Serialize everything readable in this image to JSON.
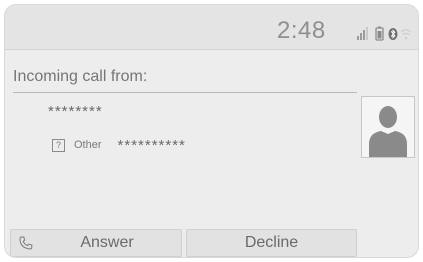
{
  "status": {
    "clock": "2:48",
    "icons": [
      "signal-icon",
      "battery-icon",
      "bluetooth-icon",
      "wifi-icon"
    ]
  },
  "call": {
    "title": "Incoming call from:",
    "caller_number": "********",
    "other_label": "Other",
    "other_number": "**********",
    "contact_icon": "person-silhouette"
  },
  "buttons": {
    "answer": "Answer",
    "decline": "Decline"
  },
  "colors": {
    "background": "#ededed",
    "text": "#6a6a6a",
    "avatar": "#8a8a8a"
  }
}
